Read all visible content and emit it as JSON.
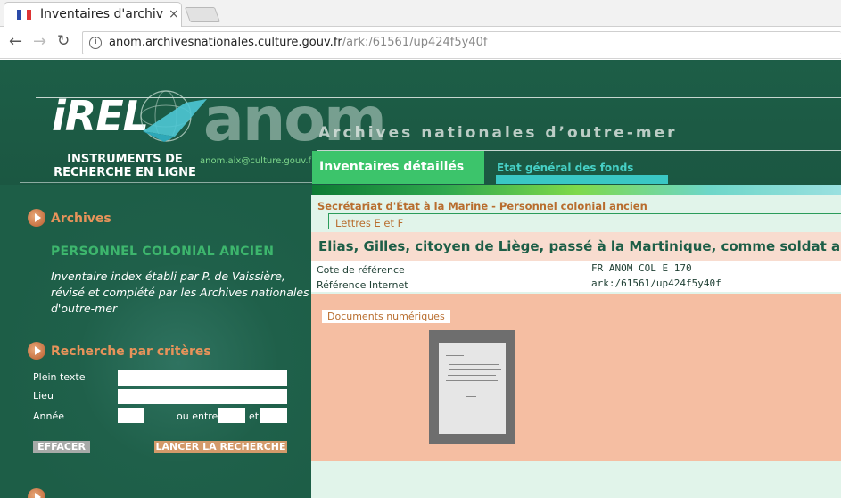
{
  "browser": {
    "tab_title": "Inventaires d'archives",
    "tab_close": "×",
    "url_host": "anom.archivesnationales.culture.gouv.fr",
    "url_path": "/ark:/61561/up424f5y40f"
  },
  "header": {
    "logo_text": "iREL",
    "logo_anom": "anom",
    "tagline": "Archives nationales d’outre-mer",
    "instruments": "INSTRUMENTS DE RECHERCHE EN LIGNE",
    "email": "anom.aix@culture.gouv.fr",
    "tab_active": "Inventaires détaillés",
    "tab_inactive": "Etat général des fonds"
  },
  "sidebar": {
    "archives_title": "Archives",
    "fonds_title": "PERSONNEL COLONIAL ANCIEN",
    "fonds_description": "Inventaire index établi par P. de Vaissière, révisé et complété par les Archives nationales d'outre-mer",
    "search_title": "Recherche par critères",
    "labels": {
      "plein_texte": "Plein texte",
      "lieu": "Lieu",
      "annee": "Année",
      "ou_entre": "ou entre",
      "et": "et"
    },
    "buttons": {
      "clear": "EFFACER",
      "search": "LANCER LA RECHERCHE"
    }
  },
  "main": {
    "breadcrumb_1": "Secrétariat d'État à la Marine - Personnel colonial ancien",
    "breadcrumb_2": "Lettres E et F",
    "record_title": "Elias, Gilles, citoyen de Liège, passé à la Martinique, comme soldat au régiment",
    "meta": [
      {
        "key": "Cote de référence",
        "value": "FR ANOM COL E 170"
      },
      {
        "key": "Référence Internet",
        "value": "ark:/61561/up424f5y40f"
      }
    ],
    "docs_label": "Documents numériques"
  },
  "colors": {
    "page_bg": "#1d5e47",
    "accent_green": "#3cc46b",
    "accent_orange": "#e8935a",
    "salmon": "#f5bea2",
    "cyan": "#3ac7c4"
  }
}
